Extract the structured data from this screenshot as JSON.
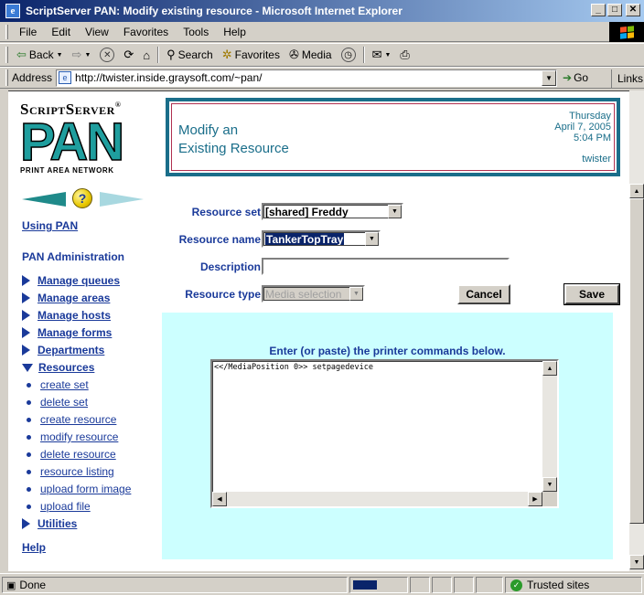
{
  "window": {
    "title": "ScriptServer PAN: Modify existing resource - Microsoft Internet Explorer"
  },
  "menu": {
    "items": [
      "File",
      "Edit",
      "View",
      "Favorites",
      "Tools",
      "Help"
    ]
  },
  "toolbar": {
    "back": "Back",
    "search": "Search",
    "favorites": "Favorites",
    "media": "Media"
  },
  "address": {
    "label": "Address",
    "url": "http://twister.inside.graysoft.com/~pan/",
    "go": "Go",
    "links": "Links"
  },
  "logo": {
    "line1": "ScriptServer",
    "line2": "PAN",
    "line3": "PRINT AREA NETWORK"
  },
  "header": {
    "title_line1": "Modify an",
    "title_line2": "Existing Resource",
    "day": "Thursday",
    "date": "April 7, 2005",
    "time": "5:04 PM",
    "host": "twister"
  },
  "nav": {
    "using_pan": "Using PAN",
    "admin_heading": "PAN Administration",
    "sections": [
      "Manage queues",
      "Manage areas",
      "Manage hosts",
      "Manage forms",
      "Departments"
    ],
    "resources": "Resources",
    "resource_links": [
      "create set",
      "delete set",
      "create resource",
      "modify resource",
      "delete resource",
      "resource listing",
      "upload form image",
      "upload file"
    ],
    "utilities": "Utilities",
    "help": "Help"
  },
  "form": {
    "resource_set_label": "Resource set",
    "resource_set_value": "[shared] Freddy",
    "resource_name_label": "Resource name",
    "resource_name_value": "TankerTopTray",
    "description_label": "Description",
    "description_value": "",
    "resource_type_label": "Resource type",
    "resource_type_value": "Media selection",
    "cancel": "Cancel",
    "save": "Save"
  },
  "commands": {
    "instruction": "Enter (or paste) the printer commands below.",
    "text": "<</MediaPosition 0>> setpagedevice"
  },
  "status": {
    "text": "Done",
    "zone": "Trusted sites"
  },
  "colors": {
    "accent": "#1a6e8a",
    "link": "#1a3a9a",
    "command_bg": "#ccffff"
  }
}
